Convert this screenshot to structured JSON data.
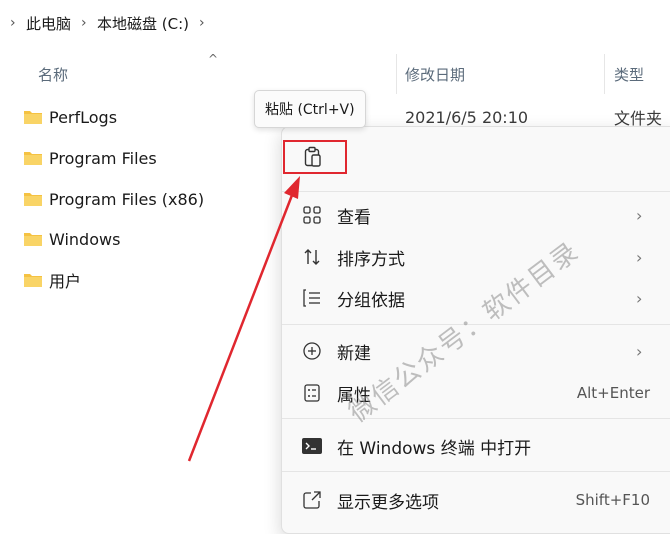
{
  "breadcrumb": {
    "items": [
      "此电脑",
      "本地磁盘 (C:)"
    ]
  },
  "columns": {
    "name": "名称",
    "modified": "修改日期",
    "type": "类型"
  },
  "files": [
    {
      "name": "PerfLogs",
      "date": "2021/6/5 20:10",
      "type": "文件夹"
    },
    {
      "name": "Program Files",
      "date": "",
      "type": ""
    },
    {
      "name": "Program Files (x86)",
      "date": "",
      "type": ""
    },
    {
      "name": "Windows",
      "date": "",
      "type": ""
    },
    {
      "name": "用户",
      "date": "",
      "type": ""
    }
  ],
  "tooltip": {
    "text": "粘贴 (Ctrl+V)"
  },
  "context_menu": {
    "items": [
      {
        "label": "查看",
        "icon": "grid-view-icon",
        "submenu": true
      },
      {
        "label": "排序方式",
        "icon": "sort-icon",
        "submenu": true
      },
      {
        "label": "分组依据",
        "icon": "group-list-icon",
        "submenu": true
      },
      {
        "label": "新建",
        "icon": "plus-circle-icon",
        "submenu": true
      },
      {
        "label": "属性",
        "icon": "properties-icon",
        "shortcut": "Alt+Enter"
      },
      {
        "label": "在 Windows 终端 中打开",
        "icon": "terminal-icon"
      },
      {
        "label": "显示更多选项",
        "icon": "share-expand-icon",
        "shortcut": "Shift+F10"
      }
    ]
  },
  "watermark": {
    "text": "微信公众号：软件目录"
  },
  "colors": {
    "highlight": "#e0272f",
    "folder": "#f5c242"
  }
}
